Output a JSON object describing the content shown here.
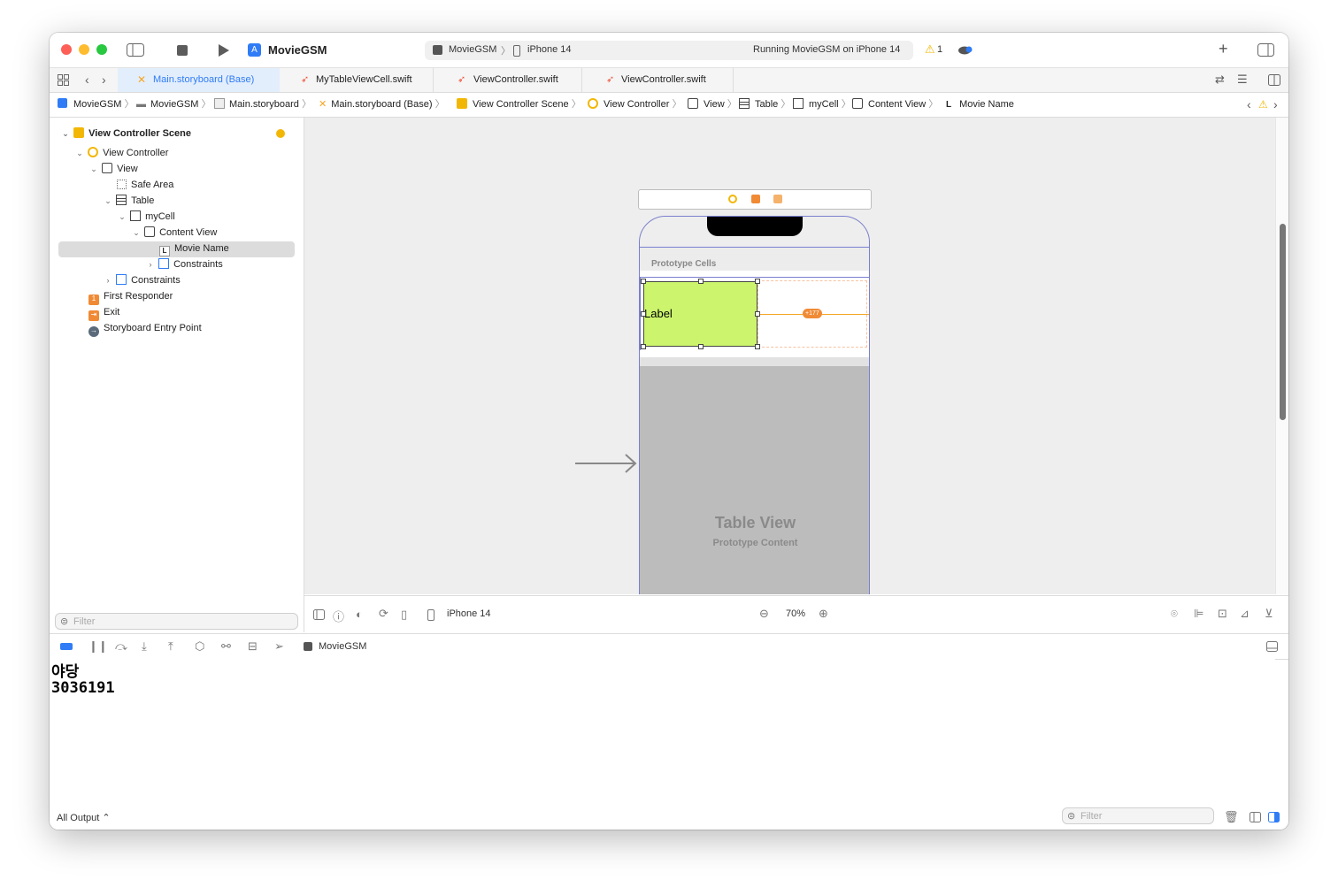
{
  "app": {
    "project": "MovieGSM"
  },
  "toolbar": {
    "scheme": "MovieGSM",
    "device": "iPhone 14",
    "status": "Running MovieGSM on iPhone 14",
    "warning_count": "1"
  },
  "tabs": [
    {
      "label": "Main.storyboard (Base)"
    },
    {
      "label": "MyTableViewCell.swift"
    },
    {
      "label": "ViewController.swift"
    },
    {
      "label": "ViewController.swift"
    }
  ],
  "breadcrumb": [
    "MovieGSM",
    "MovieGSM",
    "Main.storyboard",
    "Main.storyboard (Base)",
    "View Controller Scene",
    "View Controller",
    "View",
    "Table",
    "myCell",
    "Content View",
    "Movie Name"
  ],
  "outline": [
    {
      "label": "View Controller Scene"
    },
    {
      "label": "View Controller"
    },
    {
      "label": "View"
    },
    {
      "label": "Safe Area"
    },
    {
      "label": "Table"
    },
    {
      "label": "myCell"
    },
    {
      "label": "Content View"
    },
    {
      "label": "Movie Name"
    },
    {
      "label": "Constraints"
    },
    {
      "label": "Constraints"
    },
    {
      "label": "First Responder"
    },
    {
      "label": "Exit"
    },
    {
      "label": "Storyboard Entry Point"
    }
  ],
  "canvas": {
    "prototype_cells": "Prototype Cells",
    "label_text": "Label",
    "constraint_badge": "+177",
    "table_view_title": "Table View",
    "table_view_sub": "Prototype Content"
  },
  "canvas_bar": {
    "device": "iPhone 14",
    "zoom": "70%"
  },
  "navigator_filter": {
    "placeholder": "Filter"
  },
  "debug": {
    "target": "MovieGSM"
  },
  "console": {
    "lines": [
      "야당",
      "3036191"
    ]
  },
  "console_bar": {
    "output": "All Output ⌃",
    "filter_placeholder": "Filter"
  },
  "colors": {
    "accent": "#2F7CF6",
    "label_fill": "#CCF56D",
    "constraint": "#F5A623",
    "warning": "#F2B705"
  }
}
